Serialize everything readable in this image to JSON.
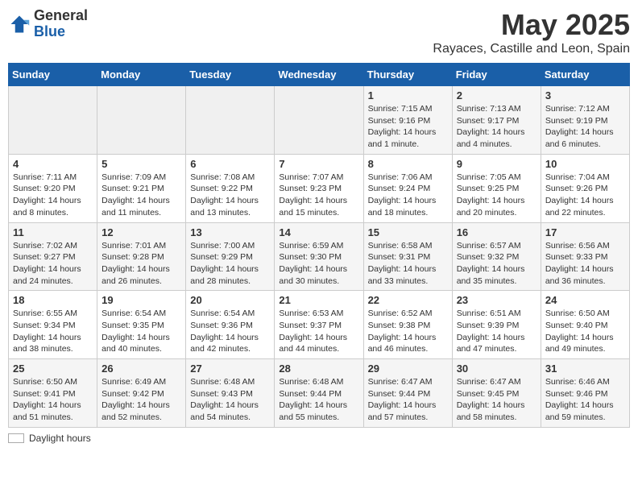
{
  "header": {
    "logo_general": "General",
    "logo_blue": "Blue",
    "month_title": "May 2025",
    "location": "Rayaces, Castille and Leon, Spain"
  },
  "legend": {
    "label": "Daylight hours"
  },
  "days_of_week": [
    "Sunday",
    "Monday",
    "Tuesday",
    "Wednesday",
    "Thursday",
    "Friday",
    "Saturday"
  ],
  "weeks": [
    [
      {
        "day": "",
        "info": ""
      },
      {
        "day": "",
        "info": ""
      },
      {
        "day": "",
        "info": ""
      },
      {
        "day": "",
        "info": ""
      },
      {
        "day": "1",
        "info": "Sunrise: 7:15 AM\nSunset: 9:16 PM\nDaylight: 14 hours\nand 1 minute."
      },
      {
        "day": "2",
        "info": "Sunrise: 7:13 AM\nSunset: 9:17 PM\nDaylight: 14 hours\nand 4 minutes."
      },
      {
        "day": "3",
        "info": "Sunrise: 7:12 AM\nSunset: 9:19 PM\nDaylight: 14 hours\nand 6 minutes."
      }
    ],
    [
      {
        "day": "4",
        "info": "Sunrise: 7:11 AM\nSunset: 9:20 PM\nDaylight: 14 hours\nand 8 minutes."
      },
      {
        "day": "5",
        "info": "Sunrise: 7:09 AM\nSunset: 9:21 PM\nDaylight: 14 hours\nand 11 minutes."
      },
      {
        "day": "6",
        "info": "Sunrise: 7:08 AM\nSunset: 9:22 PM\nDaylight: 14 hours\nand 13 minutes."
      },
      {
        "day": "7",
        "info": "Sunrise: 7:07 AM\nSunset: 9:23 PM\nDaylight: 14 hours\nand 15 minutes."
      },
      {
        "day": "8",
        "info": "Sunrise: 7:06 AM\nSunset: 9:24 PM\nDaylight: 14 hours\nand 18 minutes."
      },
      {
        "day": "9",
        "info": "Sunrise: 7:05 AM\nSunset: 9:25 PM\nDaylight: 14 hours\nand 20 minutes."
      },
      {
        "day": "10",
        "info": "Sunrise: 7:04 AM\nSunset: 9:26 PM\nDaylight: 14 hours\nand 22 minutes."
      }
    ],
    [
      {
        "day": "11",
        "info": "Sunrise: 7:02 AM\nSunset: 9:27 PM\nDaylight: 14 hours\nand 24 minutes."
      },
      {
        "day": "12",
        "info": "Sunrise: 7:01 AM\nSunset: 9:28 PM\nDaylight: 14 hours\nand 26 minutes."
      },
      {
        "day": "13",
        "info": "Sunrise: 7:00 AM\nSunset: 9:29 PM\nDaylight: 14 hours\nand 28 minutes."
      },
      {
        "day": "14",
        "info": "Sunrise: 6:59 AM\nSunset: 9:30 PM\nDaylight: 14 hours\nand 30 minutes."
      },
      {
        "day": "15",
        "info": "Sunrise: 6:58 AM\nSunset: 9:31 PM\nDaylight: 14 hours\nand 33 minutes."
      },
      {
        "day": "16",
        "info": "Sunrise: 6:57 AM\nSunset: 9:32 PM\nDaylight: 14 hours\nand 35 minutes."
      },
      {
        "day": "17",
        "info": "Sunrise: 6:56 AM\nSunset: 9:33 PM\nDaylight: 14 hours\nand 36 minutes."
      }
    ],
    [
      {
        "day": "18",
        "info": "Sunrise: 6:55 AM\nSunset: 9:34 PM\nDaylight: 14 hours\nand 38 minutes."
      },
      {
        "day": "19",
        "info": "Sunrise: 6:54 AM\nSunset: 9:35 PM\nDaylight: 14 hours\nand 40 minutes."
      },
      {
        "day": "20",
        "info": "Sunrise: 6:54 AM\nSunset: 9:36 PM\nDaylight: 14 hours\nand 42 minutes."
      },
      {
        "day": "21",
        "info": "Sunrise: 6:53 AM\nSunset: 9:37 PM\nDaylight: 14 hours\nand 44 minutes."
      },
      {
        "day": "22",
        "info": "Sunrise: 6:52 AM\nSunset: 9:38 PM\nDaylight: 14 hours\nand 46 minutes."
      },
      {
        "day": "23",
        "info": "Sunrise: 6:51 AM\nSunset: 9:39 PM\nDaylight: 14 hours\nand 47 minutes."
      },
      {
        "day": "24",
        "info": "Sunrise: 6:50 AM\nSunset: 9:40 PM\nDaylight: 14 hours\nand 49 minutes."
      }
    ],
    [
      {
        "day": "25",
        "info": "Sunrise: 6:50 AM\nSunset: 9:41 PM\nDaylight: 14 hours\nand 51 minutes."
      },
      {
        "day": "26",
        "info": "Sunrise: 6:49 AM\nSunset: 9:42 PM\nDaylight: 14 hours\nand 52 minutes."
      },
      {
        "day": "27",
        "info": "Sunrise: 6:48 AM\nSunset: 9:43 PM\nDaylight: 14 hours\nand 54 minutes."
      },
      {
        "day": "28",
        "info": "Sunrise: 6:48 AM\nSunset: 9:44 PM\nDaylight: 14 hours\nand 55 minutes."
      },
      {
        "day": "29",
        "info": "Sunrise: 6:47 AM\nSunset: 9:44 PM\nDaylight: 14 hours\nand 57 minutes."
      },
      {
        "day": "30",
        "info": "Sunrise: 6:47 AM\nSunset: 9:45 PM\nDaylight: 14 hours\nand 58 minutes."
      },
      {
        "day": "31",
        "info": "Sunrise: 6:46 AM\nSunset: 9:46 PM\nDaylight: 14 hours\nand 59 minutes."
      }
    ]
  ]
}
